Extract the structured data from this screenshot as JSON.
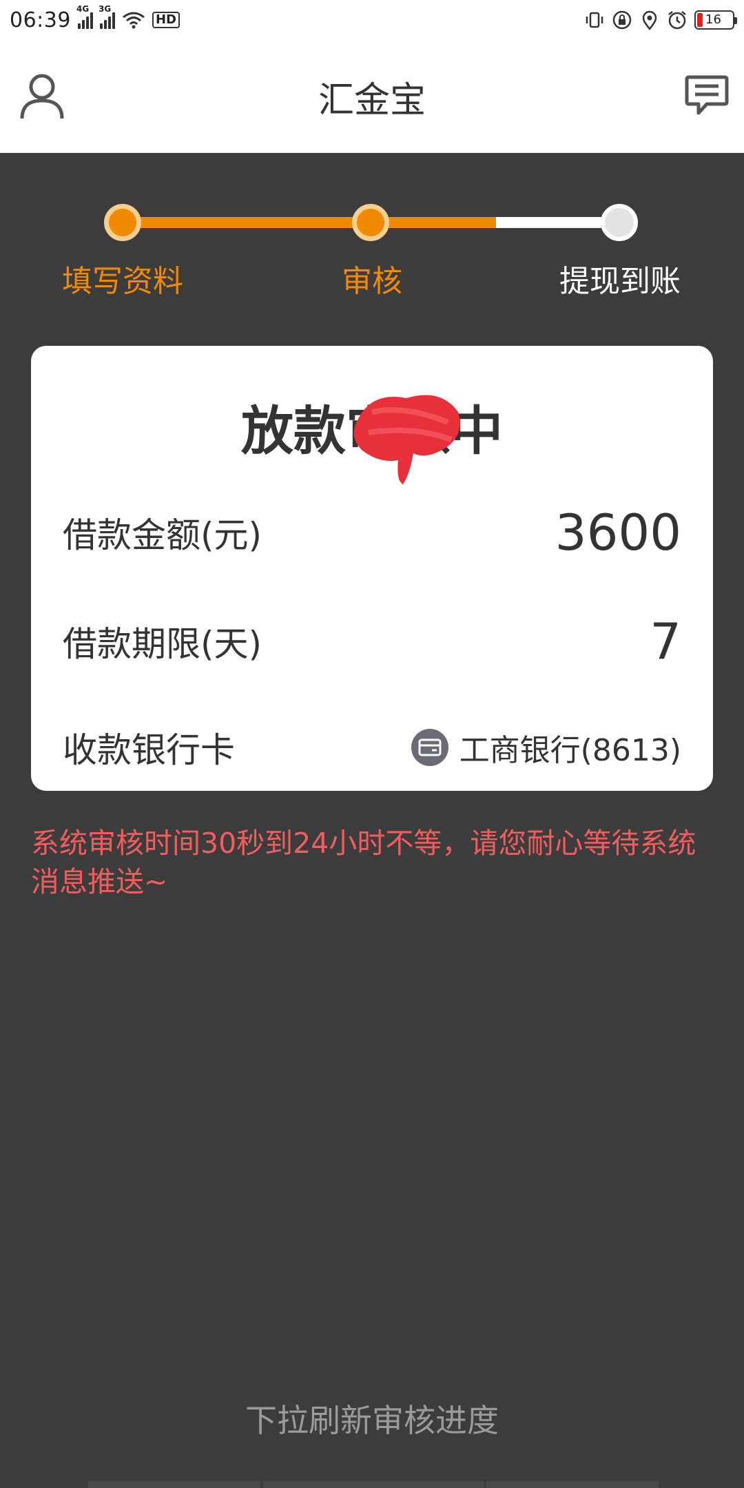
{
  "status_bar": {
    "time": "06:39",
    "network_1": "4G",
    "network_2": "3G",
    "hd_label": "HD",
    "battery_percent": "16"
  },
  "app_bar": {
    "title": "汇金宝",
    "profile_icon": "user-outline-icon",
    "message_icon": "chat-bubble-icon"
  },
  "steps": {
    "items": [
      {
        "label": "填写资料",
        "state": "done"
      },
      {
        "label": "审核",
        "state": "done"
      },
      {
        "label": "提现到账",
        "state": "pending"
      }
    ],
    "active_color": "#f18a00",
    "pending_color": "#ffffff",
    "progress_fraction": 0.75
  },
  "card": {
    "title": "放款审核中",
    "rows": [
      {
        "label": "借款金额(元)",
        "value": "3600"
      },
      {
        "label": "借款期限(天)",
        "value": "7"
      },
      {
        "label": "收款银行卡",
        "value": "工商银行(8613)",
        "icon": "bank-card-icon"
      }
    ]
  },
  "notice": "系统审核时间30秒到24小时不等，请您耐心等待系统消息推送~",
  "pull_hint": "下拉刷新审核进度",
  "colors": {
    "background": "#3c3c3c",
    "accent": "#f18a00",
    "notice": "#f25d5d",
    "redaction": "#e8303a"
  }
}
